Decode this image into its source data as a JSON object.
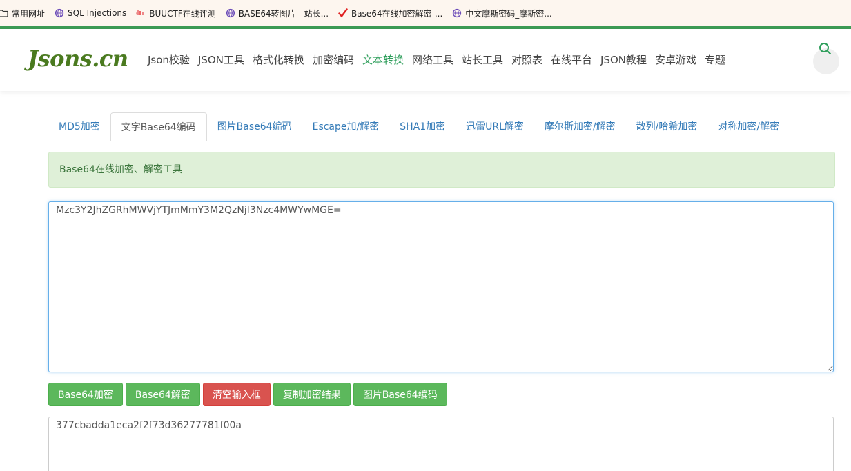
{
  "bookmarks": [
    {
      "label": "常用网址",
      "icon": "folder-icon"
    },
    {
      "label": "SQL Injections",
      "icon": "globe-icon"
    },
    {
      "label": "BUUCTF在线评测",
      "icon": "buuctf-icon"
    },
    {
      "label": "BASE64转图片 - 站长...",
      "icon": "globe-icon"
    },
    {
      "label": "Base64在线加密解密-...",
      "icon": "checkmark-icon"
    },
    {
      "label": "中文摩斯密码_摩斯密...",
      "icon": "globe-icon"
    }
  ],
  "header": {
    "logo": "Jsons.cn",
    "nav": [
      "Json校验",
      "JSON工具",
      "格式化转换",
      "加密编码",
      "文本转换",
      "网络工具",
      "站长工具",
      "对照表",
      "在线平台",
      "JSON教程",
      "安卓游戏",
      "专题"
    ],
    "active_nav_index": 4
  },
  "tabs": [
    "MD5加密",
    "文字Base64编码",
    "图片Base64编码",
    "Escape加/解密",
    "SHA1加密",
    "迅雷URL解密",
    "摩尔斯加密/解密",
    "散列/哈希加密",
    "对称加密/解密"
  ],
  "active_tab_index": 1,
  "alert": "Base64在线加密、解密工具",
  "input_text": "Mzc3Y2JhZGRhMWVjYTJmMmY3M2QzNjI3Nzc4MWYwMGE=",
  "buttons": {
    "encode": "Base64加密",
    "decode": "Base64解密",
    "clear": "清空输入框",
    "copy": "复制加密结果",
    "image": "图片Base64编码"
  },
  "output_text": "377cbadda1eca2f2f73d36277781f00a",
  "colors": {
    "accent_green": "#2e9e5b",
    "button_green": "#5cb85c",
    "button_red": "#d9534f",
    "link_blue": "#337ab7",
    "alert_bg": "#dff0d8"
  }
}
